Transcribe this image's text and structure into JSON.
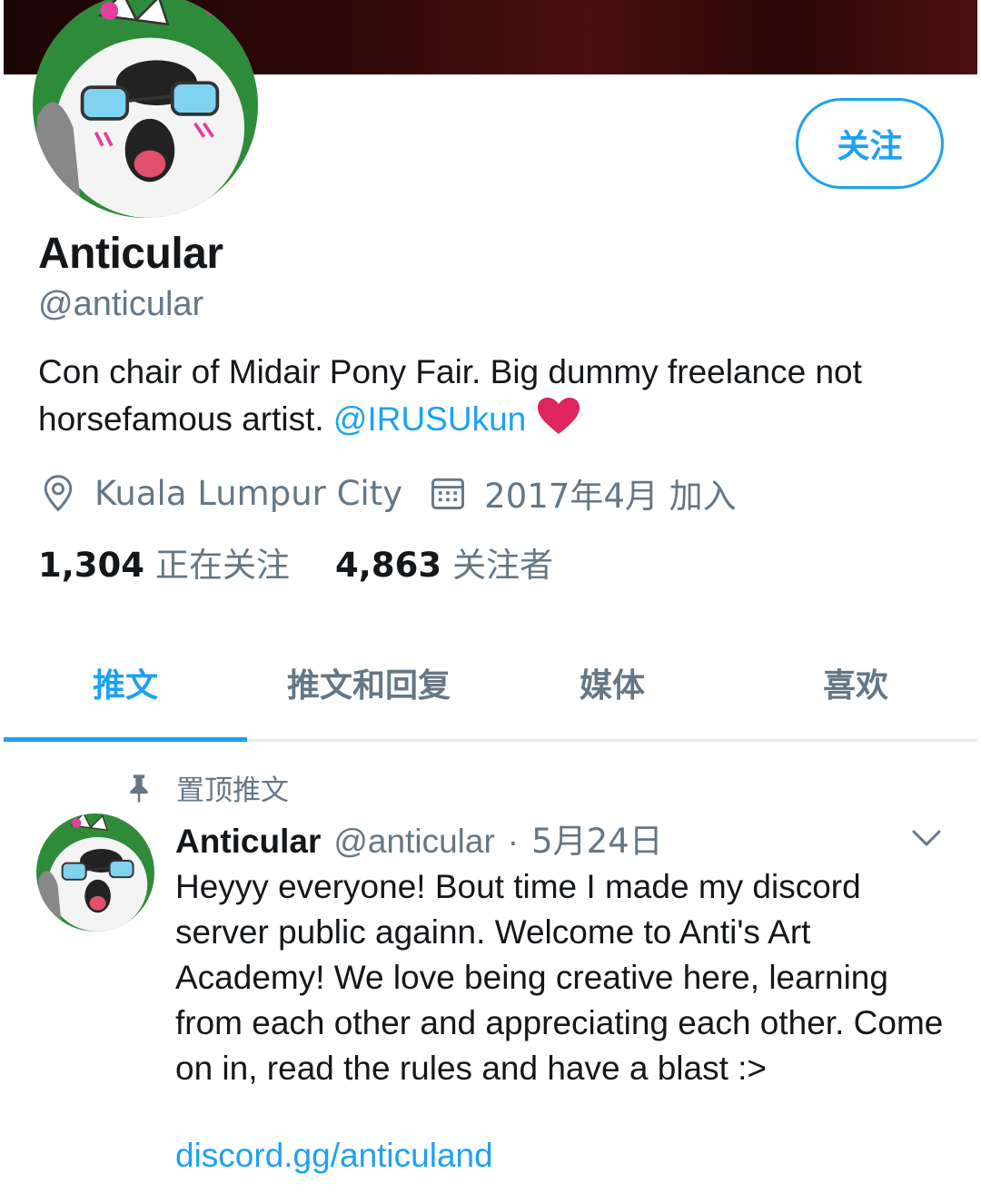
{
  "profile": {
    "display_name": "Anticular",
    "handle": "@anticular",
    "follow_label": "关注",
    "bio_text": "Con chair of Midair Pony Fair. Big dummy freelance not horsefamous artist. ",
    "bio_mention": "@IRUSUkun",
    "location": "Kuala Lumpur City",
    "joined": "2017年4月 加入",
    "following_count": "1,304",
    "following_label": "正在关注",
    "followers_count": "4,863",
    "followers_label": "关注者"
  },
  "tabs": [
    {
      "label": "推文",
      "active": true
    },
    {
      "label": "推文和回复",
      "active": false
    },
    {
      "label": "媒体",
      "active": false
    },
    {
      "label": "喜欢",
      "active": false
    }
  ],
  "tweet": {
    "pinned_label": "置顶推文",
    "author_name": "Anticular",
    "author_handle": "@anticular",
    "separator": "·",
    "date": "5月24日",
    "body": "Heyyy everyone! Bout time I made my discord server public againn. Welcome to Anti's Art Academy! We love being creative here, learning from each other and appreciating each other. Come on in, read the rules and have a blast :>",
    "link": "discord.gg/anticuland"
  },
  "icons": {
    "location": "location-pin-icon",
    "calendar": "calendar-icon",
    "pin": "pushpin-icon",
    "caret": "chevron-down-icon",
    "heart": "red-heart-emoji"
  },
  "colors": {
    "accent": "#1da1f2",
    "secondary_text": "#657786",
    "primary_text": "#14171a",
    "heart": "#e0245e"
  }
}
